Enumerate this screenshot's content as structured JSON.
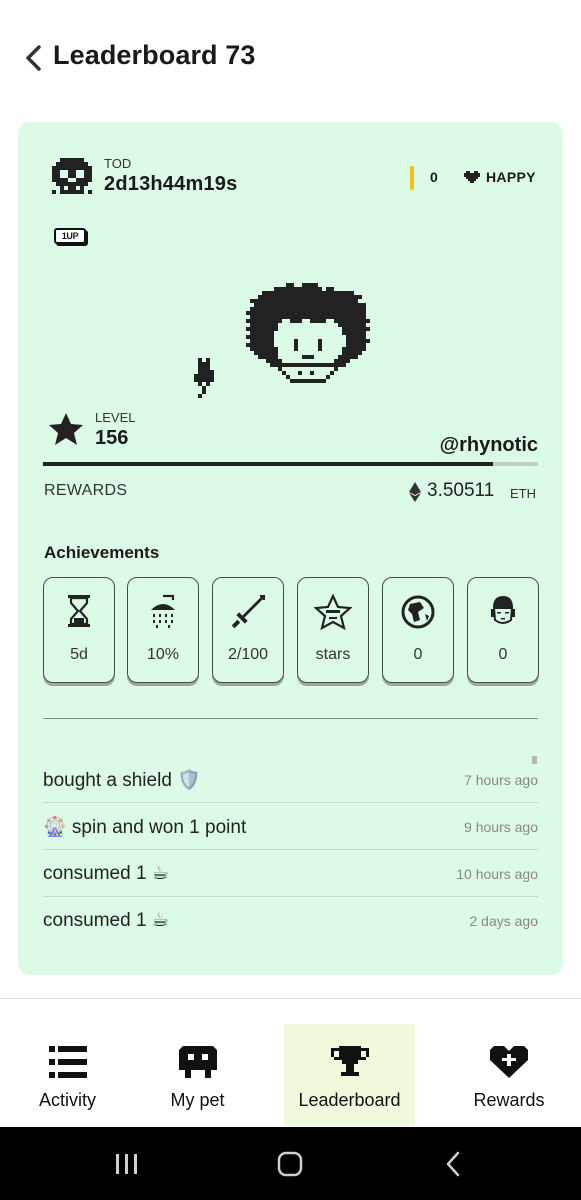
{
  "header": {
    "title": "Leaderboard 73",
    "back_icon": "chevron-left-icon"
  },
  "card": {
    "background": "#dbfbe6",
    "tod": {
      "label": "TOD",
      "value": "2d13h44m19s",
      "icon": "skull-icon"
    },
    "status": {
      "count": "0",
      "mood": "HAPPY",
      "mood_icon": "heart-icon",
      "divider_color": "#f2c21a"
    },
    "badge": "1UP",
    "level": {
      "label": "LEVEL",
      "value": "156",
      "icon": "star-icon"
    },
    "handle": "@rhynotic",
    "progress": 0.91,
    "rewards": {
      "label": "REWARDS",
      "value": "3.50511",
      "unit": "ETH",
      "icon": "ethereum-icon"
    },
    "achievements": {
      "title": "Achievements",
      "items": [
        {
          "icon": "hourglass-icon",
          "value": "5d"
        },
        {
          "icon": "shower-icon",
          "value": "10%"
        },
        {
          "icon": "sword-icon",
          "value": "2/100"
        },
        {
          "icon": "star-face-icon",
          "value": "stars"
        },
        {
          "icon": "globe-icon",
          "value": "0"
        },
        {
          "icon": "buddha-icon",
          "value": "0"
        }
      ]
    },
    "activity": [
      {
        "text": "bought a shield 🛡️",
        "time": "7 hours ago"
      },
      {
        "text": "🎡 spin and won 1 point",
        "time": "9 hours ago"
      },
      {
        "text": "consumed 1 ☕",
        "time": "10 hours ago"
      },
      {
        "text": "consumed 1 ☕",
        "time": "2 days ago"
      }
    ]
  },
  "nav": {
    "active_color": "#eefadb",
    "items": [
      {
        "label": "Activity",
        "icon": "list-icon"
      },
      {
        "label": "My pet",
        "icon": "pet-icon"
      },
      {
        "label": "Leaderboard",
        "icon": "trophy-icon",
        "active": true
      },
      {
        "label": "Rewards",
        "icon": "gift-heart-icon"
      }
    ]
  },
  "system_nav": [
    "recents-icon",
    "home-icon",
    "back-icon"
  ]
}
